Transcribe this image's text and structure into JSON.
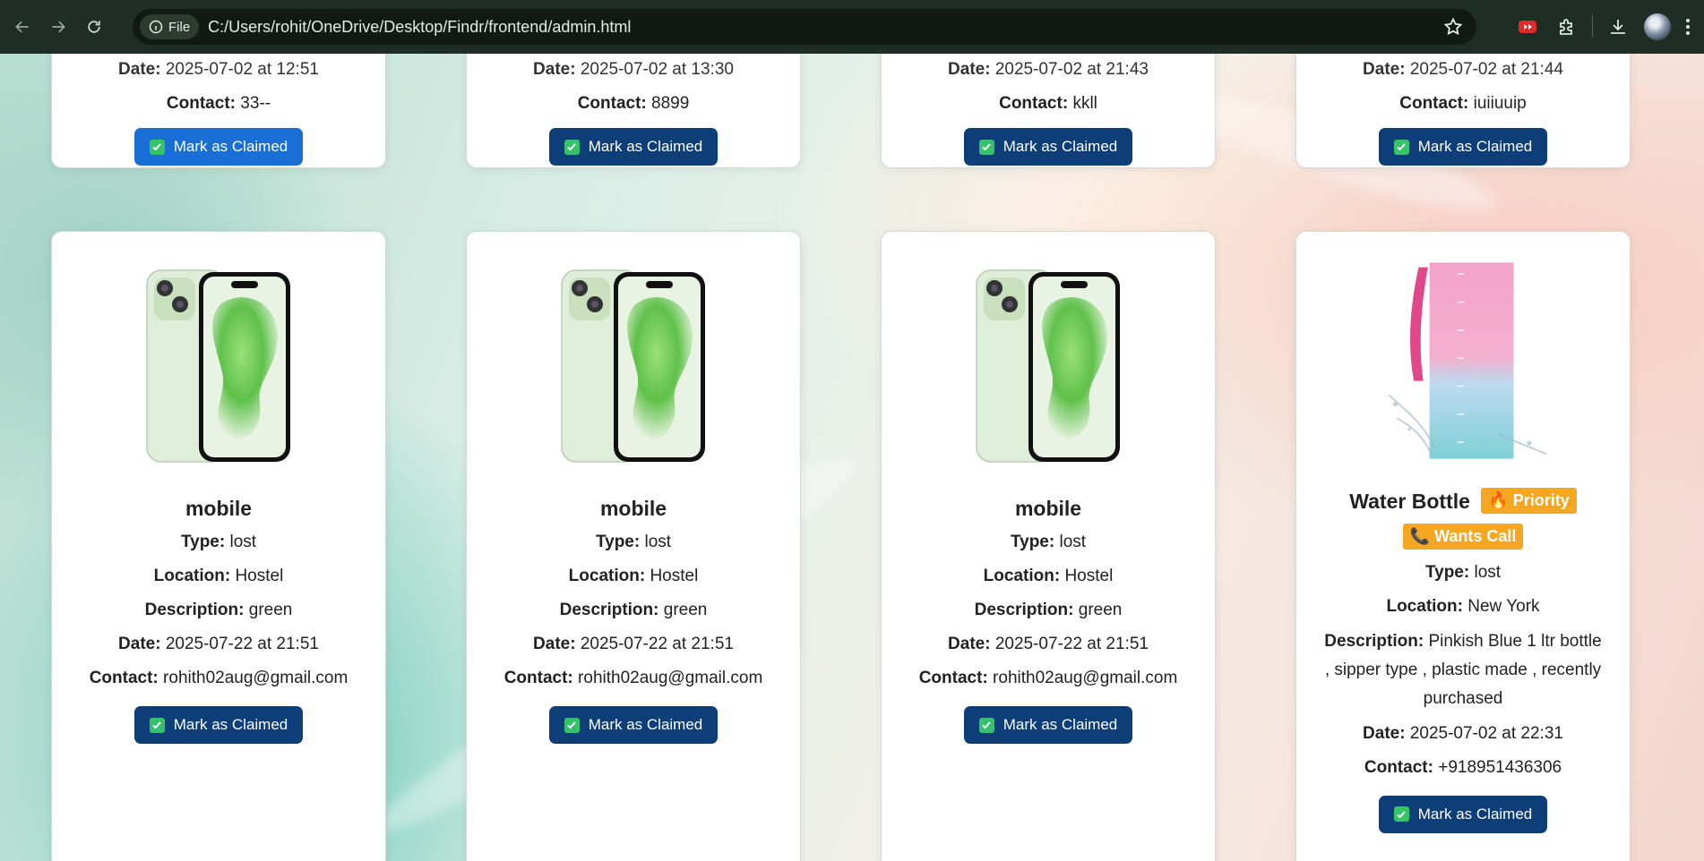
{
  "browser": {
    "chip_label": "File",
    "url": "C:/Users/rohit/OneDrive/Desktop/Findr/frontend/admin.html"
  },
  "labels": {
    "type": "Type:",
    "location": "Location:",
    "description": "Description:",
    "date": "Date:",
    "contact": "Contact:",
    "claim": "Mark as Claimed"
  },
  "top_cards": [
    {
      "date": "2025-07-02 at 12:51",
      "contact": "33--"
    },
    {
      "date": "2025-07-02 at 13:30",
      "contact": "8899"
    },
    {
      "date": "2025-07-02 at 21:43",
      "contact": "kkll"
    },
    {
      "date": "2025-07-02 at 21:44",
      "contact": "iuiiuuip"
    }
  ],
  "bottom_cards": [
    {
      "title": "mobile",
      "type": "lost",
      "location": "Hostel",
      "description": "green",
      "date": "2025-07-22 at 21:51",
      "contact": "rohith02aug@gmail.com",
      "image": "green-smartphone"
    },
    {
      "title": "mobile",
      "type": "lost",
      "location": "Hostel",
      "description": "green",
      "date": "2025-07-22 at 21:51",
      "contact": "rohith02aug@gmail.com",
      "image": "green-smartphone"
    },
    {
      "title": "mobile",
      "type": "lost",
      "location": "Hostel",
      "description": "green",
      "date": "2025-07-22 at 21:51",
      "contact": "rohith02aug@gmail.com",
      "image": "green-smartphone"
    },
    {
      "title": "Water Bottle",
      "badges": [
        "🔥 Priority",
        "📞 Wants Call"
      ],
      "type": "lost",
      "location": "New York",
      "description": "Pinkish Blue 1 ltr bottle , sipper type , plastic made , recently purchased",
      "date": "2025-07-02 at 22:31",
      "contact": "+918951436306",
      "image": "water-bottle"
    }
  ],
  "colors": {
    "button": "#0d3e78",
    "button_active": "#1a6fd6",
    "badge": "#f5a623"
  }
}
